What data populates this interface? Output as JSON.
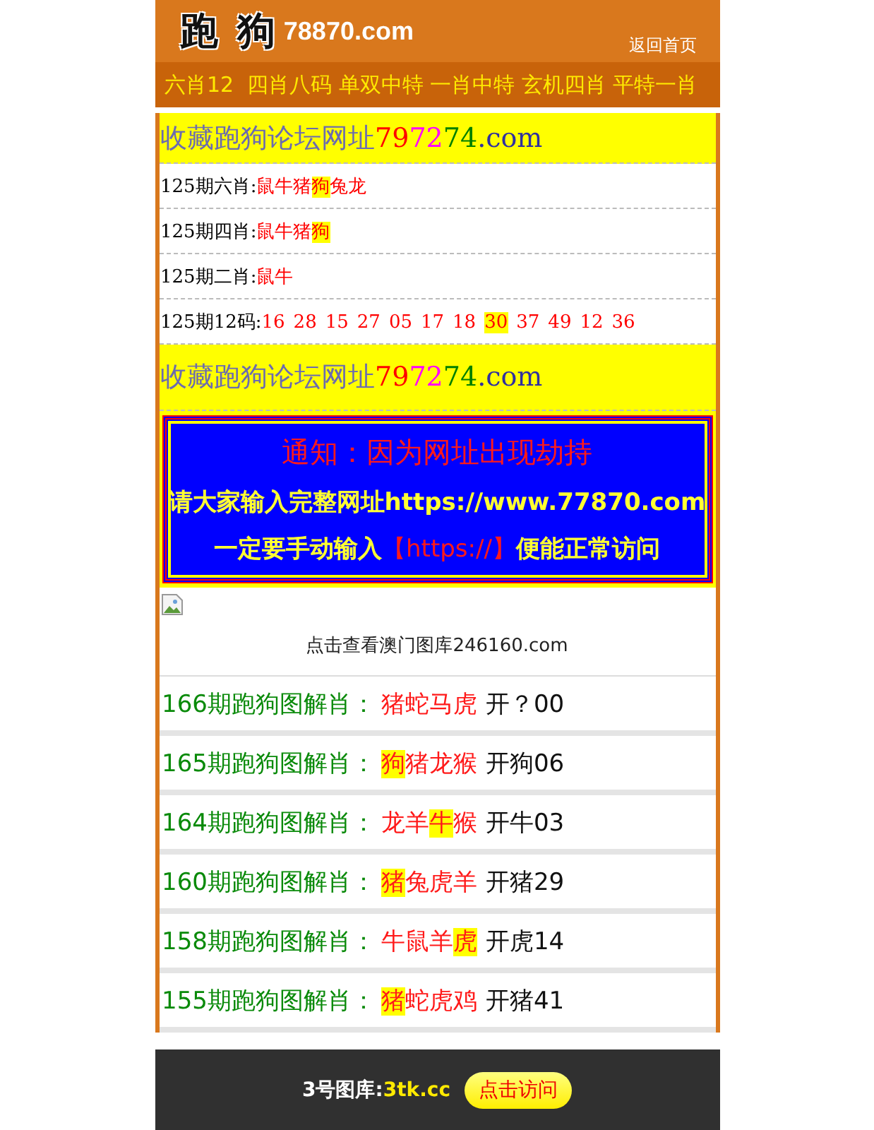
{
  "header": {
    "logo": "跑 狗",
    "domain": "78870.com",
    "home_link": "返回首页"
  },
  "marquee": "六肖12  四肖八码 单双中特 一肖中特 玄机四肖 平特一肖",
  "banner_top": {
    "segments": [
      {
        "t": "收藏跑狗论坛网址",
        "color": "#6b6bb0"
      },
      {
        "t": "79",
        "color": "#ff0000"
      },
      {
        "t": "72",
        "color": "#ff00ff"
      },
      {
        "t": "74",
        "color": "#008000"
      },
      {
        "t": ".com",
        "color": "#3030a0"
      }
    ]
  },
  "predictions": [
    {
      "label": "125期六肖:",
      "picks": [
        {
          "t": "鼠",
          "hit": false
        },
        {
          "t": "牛",
          "hit": false
        },
        {
          "t": "猪",
          "hit": false
        },
        {
          "t": "狗",
          "hit": true
        },
        {
          "t": "兔",
          "hit": false
        },
        {
          "t": "龙",
          "hit": false
        }
      ]
    },
    {
      "label": "125期四肖:",
      "picks": [
        {
          "t": "鼠",
          "hit": false
        },
        {
          "t": "牛",
          "hit": false
        },
        {
          "t": "猪",
          "hit": false
        },
        {
          "t": "狗",
          "hit": true
        }
      ]
    },
    {
      "label": "125期二肖:",
      "picks": [
        {
          "t": "鼠",
          "hit": false
        },
        {
          "t": "牛",
          "hit": false
        }
      ]
    },
    {
      "label": "125期12码:",
      "kind": "numbers",
      "picks": [
        {
          "t": "16",
          "hit": false
        },
        {
          "t": "28",
          "hit": false
        },
        {
          "t": "15",
          "hit": false
        },
        {
          "t": "27",
          "hit": false
        },
        {
          "t": "05",
          "hit": false
        },
        {
          "t": "17",
          "hit": false
        },
        {
          "t": "18",
          "hit": false
        },
        {
          "t": "30",
          "hit": true
        },
        {
          "t": "37",
          "hit": false
        },
        {
          "t": "49",
          "hit": false
        },
        {
          "t": "12",
          "hit": false
        },
        {
          "t": "36",
          "hit": false
        }
      ]
    }
  ],
  "banner_bottom": {
    "segments": [
      {
        "t": "收藏跑狗论坛网址",
        "color": "#6b6bb0"
      },
      {
        "t": "79",
        "color": "#ff0000"
      },
      {
        "t": "72",
        "color": "#ff00ff"
      },
      {
        "t": "74",
        "color": "#008000"
      },
      {
        "t": ".com",
        "color": "#3030a0"
      }
    ]
  },
  "notice": {
    "lines": [
      [
        {
          "t": "通知：因为网址出现劫持",
          "alert": true
        }
      ],
      [
        {
          "t": "请大家输入完整网址https://www.77870.com",
          "alert": false
        }
      ],
      [
        {
          "t": "一定要手动输入",
          "alert": false
        },
        {
          "t": "【https://】",
          "alert": true
        },
        {
          "t": "便能正常访问",
          "alert": false
        }
      ]
    ]
  },
  "gallery_link": "点击查看澳门图库246160.com",
  "history": [
    {
      "label": "166期跑狗图解肖：",
      "picks": [
        {
          "t": "猪",
          "hit": false
        },
        {
          "t": "蛇",
          "hit": false
        },
        {
          "t": "马",
          "hit": false
        },
        {
          "t": "虎",
          "hit": false
        }
      ],
      "result": "开？00"
    },
    {
      "label": "165期跑狗图解肖：",
      "picks": [
        {
          "t": "狗",
          "hit": true
        },
        {
          "t": "猪",
          "hit": false
        },
        {
          "t": "龙",
          "hit": false
        },
        {
          "t": "猴",
          "hit": false
        }
      ],
      "result": "开狗06"
    },
    {
      "label": "164期跑狗图解肖：",
      "picks": [
        {
          "t": "龙",
          "hit": false
        },
        {
          "t": "羊",
          "hit": false
        },
        {
          "t": "牛",
          "hit": true
        },
        {
          "t": "猴",
          "hit": false
        }
      ],
      "result": "开牛03"
    },
    {
      "label": "160期跑狗图解肖：",
      "picks": [
        {
          "t": "猪",
          "hit": true
        },
        {
          "t": "兔",
          "hit": false
        },
        {
          "t": "虎",
          "hit": false
        },
        {
          "t": "羊",
          "hit": false
        }
      ],
      "result": "开猪29"
    },
    {
      "label": "158期跑狗图解肖：",
      "picks": [
        {
          "t": "牛",
          "hit": false
        },
        {
          "t": "鼠",
          "hit": false
        },
        {
          "t": "羊",
          "hit": false
        },
        {
          "t": "虎",
          "hit": true
        }
      ],
      "result": "开虎14"
    },
    {
      "label": "155期跑狗图解肖：",
      "picks": [
        {
          "t": "猪",
          "hit": true
        },
        {
          "t": "蛇",
          "hit": false
        },
        {
          "t": "虎",
          "hit": false
        },
        {
          "t": "鸡",
          "hit": false
        }
      ],
      "result": "开猪41"
    }
  ],
  "footer_bar": {
    "label": "3号图库:",
    "site": "3tk.cc",
    "button": "点击访问"
  }
}
